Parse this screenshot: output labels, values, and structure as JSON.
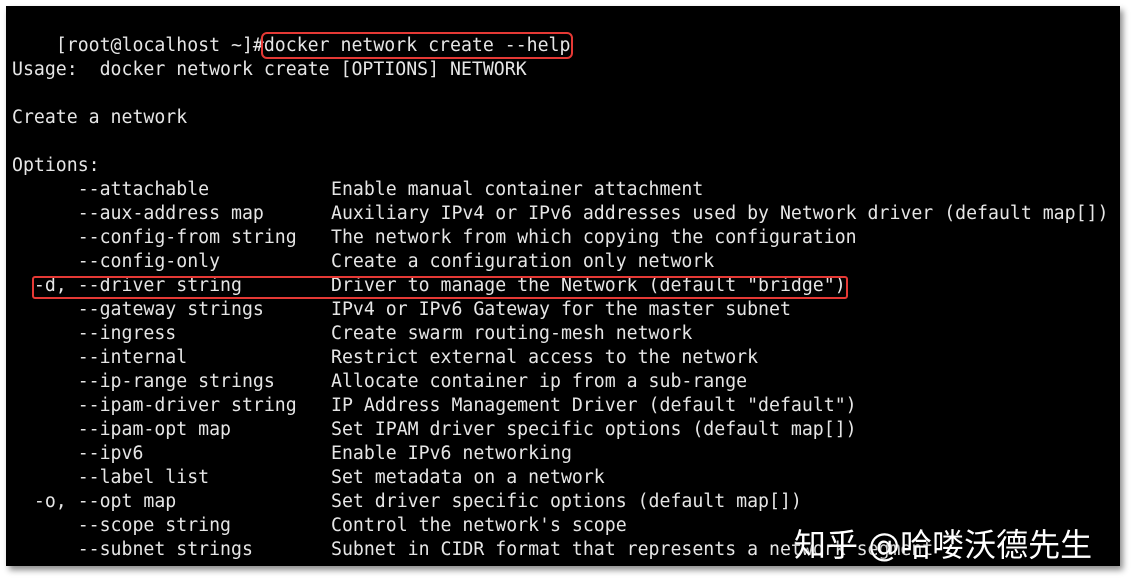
{
  "prompt": {
    "user_host": "[root@localhost ~]#",
    "command": "docker network create --help"
  },
  "usage": "Usage:  docker network create [OPTIONS] NETWORK",
  "description": "Create a network",
  "options_header": "Options:",
  "options": [
    {
      "flag": "      --attachable",
      "desc": "Enable manual container attachment"
    },
    {
      "flag": "      --aux-address map",
      "desc": "Auxiliary IPv4 or IPv6 addresses used by Network driver (default map[])"
    },
    {
      "flag": "      --config-from string",
      "desc": "The network from which copying the configuration"
    },
    {
      "flag": "      --config-only",
      "desc": "Create a configuration only network"
    },
    {
      "flag": "  -d, --driver string",
      "desc": "Driver to manage the Network (default \"bridge\")"
    },
    {
      "flag": "      --gateway strings",
      "desc": "IPv4 or IPv6 Gateway for the master subnet"
    },
    {
      "flag": "      --ingress",
      "desc": "Create swarm routing-mesh network"
    },
    {
      "flag": "      --internal",
      "desc": "Restrict external access to the network"
    },
    {
      "flag": "      --ip-range strings",
      "desc": "Allocate container ip from a sub-range"
    },
    {
      "flag": "      --ipam-driver string",
      "desc": "IP Address Management Driver (default \"default\")"
    },
    {
      "flag": "      --ipam-opt map",
      "desc": "Set IPAM driver specific options (default map[])"
    },
    {
      "flag": "      --ipv6",
      "desc": "Enable IPv6 networking"
    },
    {
      "flag": "      --label list",
      "desc": "Set metadata on a network"
    },
    {
      "flag": "  -o, --opt map",
      "desc": "Set driver specific options (default map[])"
    },
    {
      "flag": "      --scope string",
      "desc": "Control the network's scope"
    },
    {
      "flag": "      --subnet strings",
      "desc": "Subnet in CIDR format that represents a network segment"
    }
  ],
  "watermark": "知乎 @哈喽沃德先生",
  "colors": {
    "terminal_bg": "#000000",
    "text": "#e6e6e6",
    "highlight_border": "#e53935"
  }
}
